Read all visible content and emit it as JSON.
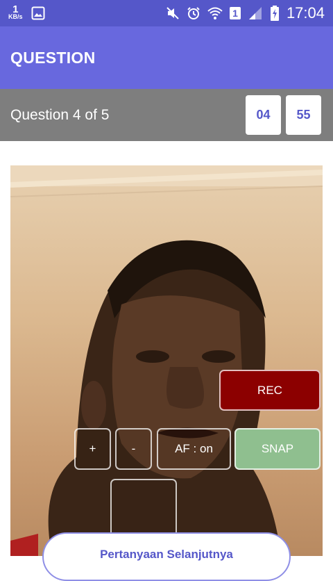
{
  "status_bar": {
    "net_speed_value": "1",
    "net_speed_unit": "KB/s",
    "time": "17:04",
    "sim_badge": "1",
    "icons": [
      "image-icon",
      "mute-icon",
      "alarm-icon",
      "wifi-icon",
      "signal-icon",
      "battery-charging-icon"
    ]
  },
  "app_bar": {
    "title": "QUESTION"
  },
  "question": {
    "progress_text": "Question 4 of 5",
    "timer_minutes": "04",
    "timer_seconds": "55"
  },
  "camera": {
    "controls": {
      "rec_label": "REC",
      "plus_label": "+",
      "minus_label": "-",
      "af_label": "AF : on",
      "snap_label": "SNAP"
    }
  },
  "next_button": {
    "label": "Pertanyaan Selanjutnya"
  },
  "colors": {
    "status_bar": "#5557c9",
    "app_bar": "#6868de",
    "question_bar": "#7e7e7e",
    "rec": "#8c0000",
    "snap": "#8fbf8f",
    "accent_text": "#5557c9"
  }
}
